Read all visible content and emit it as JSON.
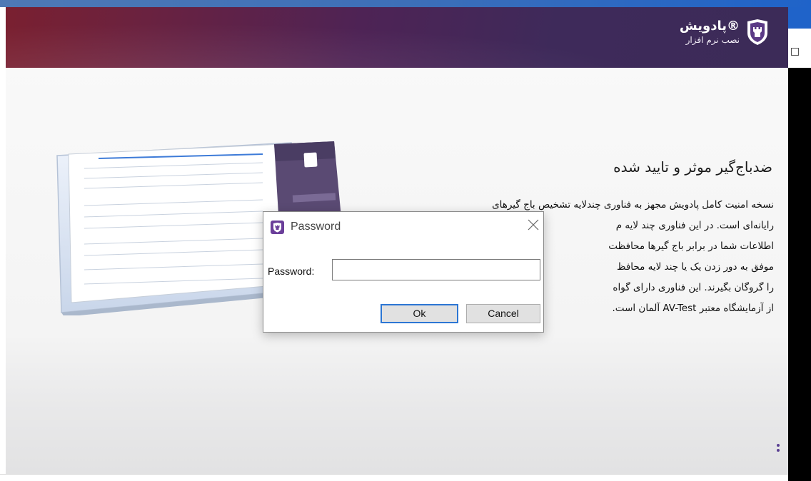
{
  "brand": {
    "name": "پادویش®",
    "subtitle": "نصب نرم افزار"
  },
  "content": {
    "headline": "ضدباج‌گیر موثر و تایید شده",
    "paragraph_lines": [
      "نسخه امنیت کامل پادویش مجهز به فناوری چندلایه تشخیص باج گیرهای",
      "رایانه‌ای است. در این فناوری چند لایه م",
      "اطلاعات شما در برابر باج گیرها محافظت",
      "موفق به دور زدن یک یا چند لایه محافظ",
      "را گروگان بگیرند. این فناوری دارای گواه",
      "از آزمایشگاه معتبر AV-Test آلمان است."
    ]
  },
  "dialog": {
    "title": "Password",
    "field_label": "Password:",
    "field_value": "",
    "ok_label": "Ok",
    "cancel_label": "Cancel"
  },
  "colors": {
    "banner_start": "#7a2030",
    "banner_end": "#3c2b58",
    "accent": "#5a3f93",
    "focus_border": "#2c76d4"
  },
  "icons": [
    "padvish-shield-logo",
    "padvish-app-icon",
    "close-icon",
    "progress-dots-icon"
  ]
}
